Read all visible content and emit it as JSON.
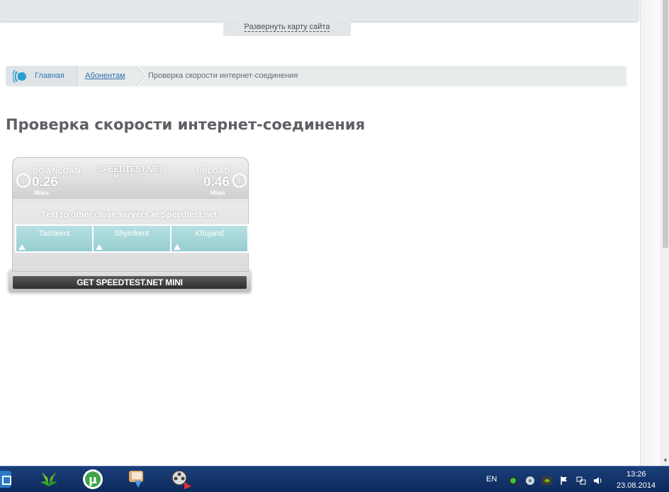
{
  "header": {
    "sitemap_toggle": "Развернуть карту сайта"
  },
  "breadcrumb": {
    "home": "Главная",
    "section": "Абонентам",
    "current": "Проверка скорости интернет-соединения"
  },
  "page": {
    "title": "Проверка скорости интернет-соединения"
  },
  "speedtest": {
    "brand": "SPEEDTEST.NET",
    "brand_sub": "MINI",
    "download_label": "DOWNLOAD",
    "download_value": "0.26",
    "download_unit": "Mbps",
    "upload_label": "UPLOAD",
    "upload_value": "0.46",
    "upload_unit": "Mbps",
    "test_text": "Test to other close servers at Speedtest.net:",
    "servers": [
      "Tashkent",
      "Shymkent",
      "Khujand"
    ],
    "get_button": "GET SPEEDTEST.NET MINI",
    "accent_color": "#9fd4d6"
  },
  "taskbar": {
    "apps": [
      "maxthon-browser-icon",
      "butterfly-app-icon",
      "utorrent-icon",
      "downloader-icon",
      "media-player-icon"
    ],
    "language": "EN",
    "time": "13:26",
    "date": "23.08.2014"
  }
}
